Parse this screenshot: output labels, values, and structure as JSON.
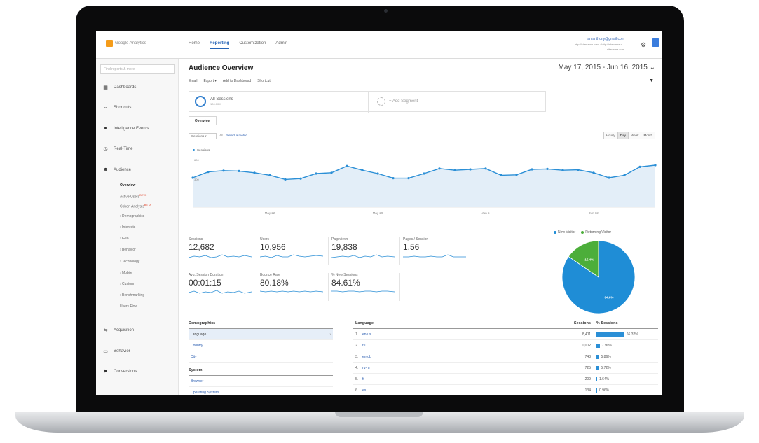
{
  "app": {
    "logo_text": "Google Analytics"
  },
  "top_nav": [
    "Home",
    "Reporting",
    "Customization",
    "Admin"
  ],
  "account": {
    "email": "iamanthony@gmail.com",
    "urls": "http://sitename.com · http://sitename.c...",
    "subsite": "sitename.com"
  },
  "sidebar": {
    "search_placeholder": "Find reports & more",
    "items": [
      "Dashboards",
      "Shortcuts",
      "Intelligence Events",
      "Real-Time",
      "Audience",
      "Acquisition",
      "Behavior",
      "Conversions"
    ],
    "audience_sub": [
      "Overview",
      "Active Users",
      "Cohort Analysis",
      "› Demographics",
      "› Interests",
      "› Geo",
      "› Behavior",
      "› Technology",
      "› Mobile",
      "› Custom",
      "› Benchmarking",
      "Users Flow"
    ],
    "beta": "BETA"
  },
  "header": {
    "title": "Audience Overview",
    "date_range": "May 17, 2015 - Jun 16, 2015"
  },
  "toolbar": [
    "Email",
    "Export ▾",
    "Add to Dashboard",
    "Shortcut"
  ],
  "segments": {
    "all_label": "All Sessions",
    "all_sub": "100.00%",
    "add_label": "+ Add Segment"
  },
  "tabs": {
    "overview": "Overview"
  },
  "controls": {
    "metric": "Sessions ▾",
    "vs": "VS",
    "select_metric": "Select a metric",
    "granularity": [
      "Hourly",
      "Day",
      "Week",
      "Month"
    ],
    "granularity_active": "Day"
  },
  "chart_data": [
    {
      "type": "line",
      "legend": "Sessions",
      "ylim": [
        0,
        600
      ],
      "y_ticks": [
        "600",
        "300"
      ],
      "x_ticks": [
        "May 22",
        "May 29",
        "Jun 5",
        "Jun 12"
      ],
      "series": [
        {
          "name": "Sessions",
          "values": [
            350,
            420,
            435,
            430,
            410,
            380,
            330,
            340,
            400,
            410,
            490,
            440,
            400,
            345,
            345,
            400,
            460,
            440,
            450,
            460,
            380,
            385,
            450,
            455,
            440,
            445,
            410,
            350,
            380,
            480,
            500
          ]
        }
      ]
    },
    {
      "type": "pie",
      "legend": [
        "New Visitor",
        "Returning Visitor"
      ],
      "values": [
        84.6,
        15.4
      ],
      "labels": [
        "84.6%",
        "15.4%"
      ],
      "colors": [
        "#1f8dd6",
        "#4cae3a"
      ]
    }
  ],
  "kpis": [
    {
      "label": "Sessions",
      "value": "12,682"
    },
    {
      "label": "Users",
      "value": "10,956"
    },
    {
      "label": "Pageviews",
      "value": "19,838"
    },
    {
      "label": "Pages / Session",
      "value": "1.56"
    },
    {
      "label": "Avg. Session Duration",
      "value": "00:01:15"
    },
    {
      "label": "Bounce Rate",
      "value": "80.18%"
    },
    {
      "label": "% New Sessions",
      "value": "84.61%"
    }
  ],
  "demographics": {
    "title": "Demographics",
    "rows": [
      "Language",
      "Country",
      "City"
    ],
    "system_title": "System",
    "system_rows": [
      "Browser",
      "Operating System"
    ]
  },
  "language_table": {
    "headers": {
      "language": "Language",
      "sessions": "Sessions",
      "pct": "% Sessions"
    },
    "rows": [
      {
        "n": "1.",
        "lang": "en-us",
        "sessions": "8,411",
        "pct": "66.32%",
        "share": 66.32
      },
      {
        "n": "2.",
        "lang": "ru",
        "sessions": "1,002",
        "pct": "7.90%",
        "share": 7.9
      },
      {
        "n": "3.",
        "lang": "en-gb",
        "sessions": "743",
        "pct": "5.86%",
        "share": 5.86
      },
      {
        "n": "4.",
        "lang": "ru-ru",
        "sessions": "725",
        "pct": "5.72%",
        "share": 5.72
      },
      {
        "n": "5.",
        "lang": "fr",
        "sessions": "209",
        "pct": "1.64%",
        "share": 1.64
      },
      {
        "n": "6.",
        "lang": "es",
        "sessions": "134",
        "pct": "0.96%",
        "share": 0.96
      }
    ]
  },
  "colors": {
    "accent": "#2b8fd6",
    "line": "#2b8fd6",
    "area": "#e3eef8"
  }
}
